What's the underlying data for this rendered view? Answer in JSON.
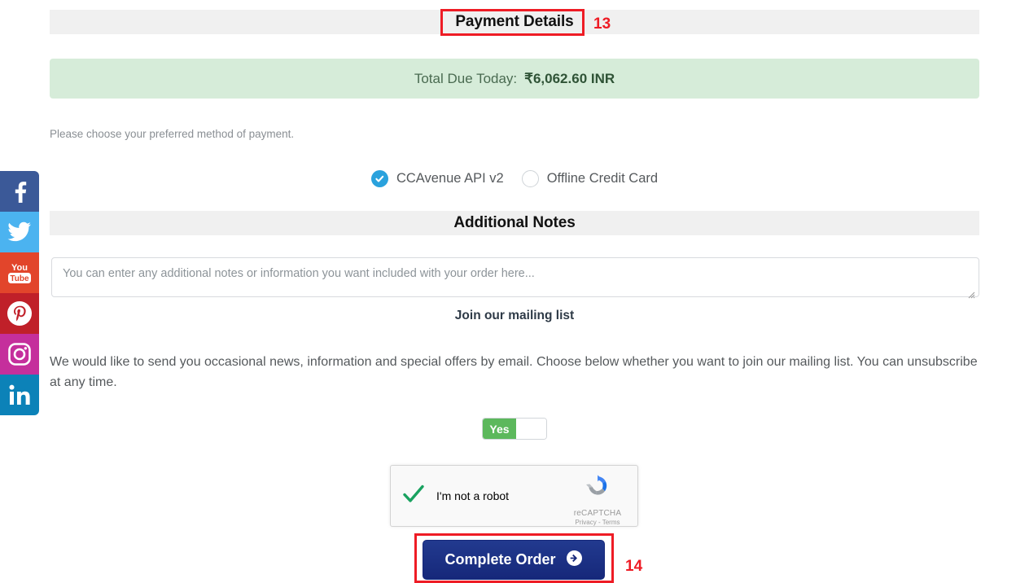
{
  "social": {
    "items": [
      {
        "name": "facebook",
        "label": "Facebook",
        "color": "#3b5998"
      },
      {
        "name": "twitter",
        "label": "Twitter",
        "color": "#4bb3f0"
      },
      {
        "name": "youtube",
        "label": "YouTube",
        "color": "#e2452b"
      },
      {
        "name": "pinterest",
        "label": "Pinterest",
        "color": "#c02029"
      },
      {
        "name": "instagram",
        "label": "Instagram",
        "color": "#c52f9c"
      },
      {
        "name": "linkedin",
        "label": "LinkedIn",
        "color": "#0c82b8"
      }
    ]
  },
  "payment": {
    "section_title": "Payment Details",
    "annotation": "13",
    "total_label": "Total Due Today:",
    "total_value": "₹6,062.60 INR",
    "instruction": "Please choose your preferred method of payment.",
    "methods": [
      {
        "label": "CCAvenue API v2",
        "selected": true
      },
      {
        "label": "Offline Credit Card",
        "selected": false
      }
    ]
  },
  "notes": {
    "section_title": "Additional Notes",
    "placeholder": "You can enter any additional notes or information you want included with your order here...",
    "value": ""
  },
  "mailing": {
    "title": "Join our mailing list",
    "body": "We would like to send you occasional news, information and special offers by email. Choose below whether you want to join our mailing list. You can unsubscribe at any time.",
    "toggle_on_label": "Yes",
    "toggle_state": "Yes"
  },
  "captcha": {
    "label": "I'm not a robot",
    "brand": "reCAPTCHA",
    "links": "Privacy - Terms",
    "verified": true
  },
  "submit": {
    "label": "Complete Order",
    "annotation": "14"
  },
  "colors": {
    "accent_blue": "#2aa2dd",
    "button_navy": "#16287a",
    "annotation_red": "#ee1c25",
    "success_green": "#5cb85c",
    "banner_green": "#d6ecd9"
  }
}
